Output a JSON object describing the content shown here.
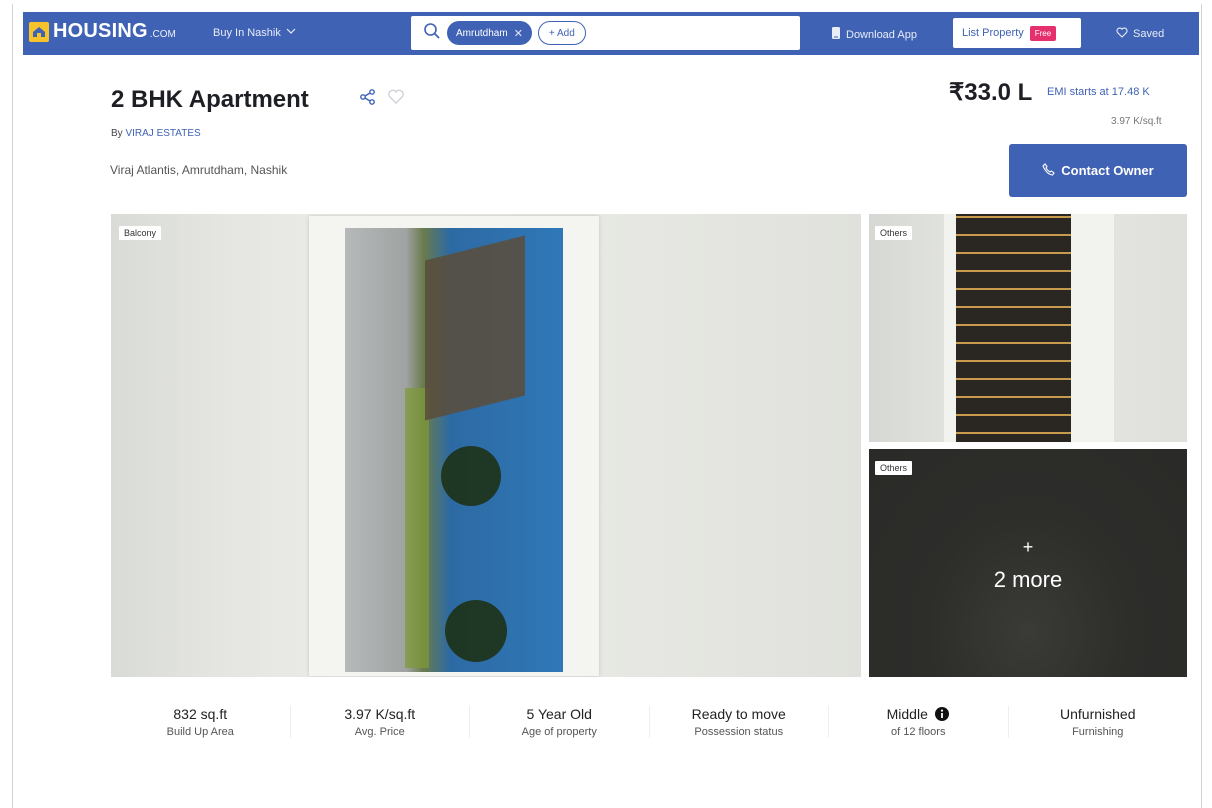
{
  "header": {
    "logo_text": "HOUSING",
    "logo_suffix": ".COM",
    "city_selector": "Buy In Nashik",
    "search_chip": "Amrutdham",
    "add_label": "+ Add",
    "download_app": "Download App",
    "list_property": "List Property",
    "free_badge": "Free",
    "saved": "Saved"
  },
  "listing": {
    "title": "2 BHK Apartment",
    "by_prefix": "By",
    "developer": "VIRAJ ESTATES",
    "address": "Viraj Atlantis, Amrutdham, Nashik",
    "price": "₹33.0 L",
    "emi": "EMI starts at  17.48 K",
    "price_per_sqft": "3.97 K/sq.ft",
    "contact_button": "Contact Owner"
  },
  "gallery": {
    "main_tag": "Balcony",
    "side_top_tag": "Others",
    "side_bottom_tag": "Others",
    "more_plus": "+",
    "more_text": "2 more"
  },
  "stats": [
    {
      "value": "832 sq.ft",
      "label": "Build Up Area"
    },
    {
      "value": "3.97 K/sq.ft",
      "label": "Avg. Price"
    },
    {
      "value": "5 Year Old",
      "label": "Age of property"
    },
    {
      "value": "Ready to move",
      "label": "Possession status"
    },
    {
      "value": "Middle",
      "label": "of 12 floors"
    },
    {
      "value": "Unfurnished",
      "label": "Furnishing"
    }
  ],
  "colors": {
    "brand_blue": "#3f62b4",
    "logo_yellow": "#f8c32a",
    "free_pink": "#e6306d"
  },
  "icons": [
    "house-logo-icon",
    "chevron-down-icon",
    "search-icon",
    "close-icon",
    "download-icon",
    "heart-icon",
    "share-icon",
    "phone-icon",
    "info-icon"
  ]
}
